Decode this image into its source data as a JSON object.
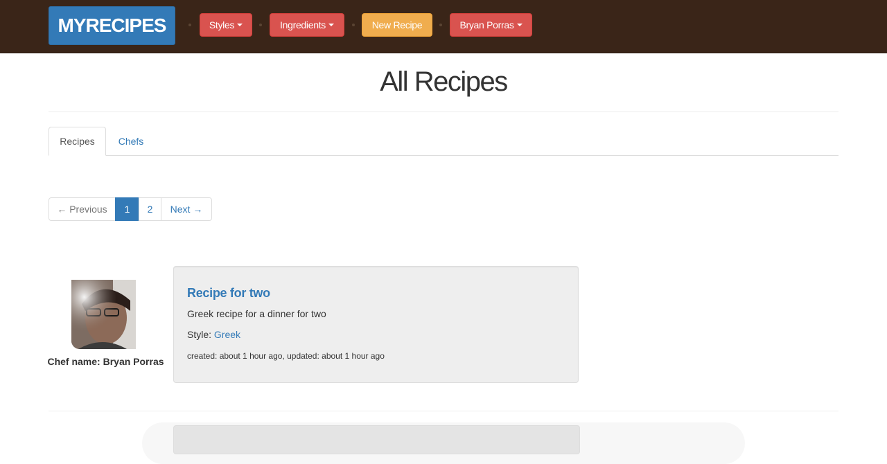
{
  "navbar": {
    "logo": "MYRECIPES",
    "styles_label": "Styles",
    "ingredients_label": "Ingredients",
    "new_recipe_label": "New Recipe",
    "user_label": "Bryan Porras",
    "colors": {
      "bar": "#3a2518",
      "logo": "#337ab7",
      "danger": "#d9534f",
      "warning": "#f0ad4e"
    }
  },
  "page": {
    "title": "All Recipes"
  },
  "tabs": [
    {
      "label": "Recipes",
      "active": true
    },
    {
      "label": "Chefs",
      "active": false
    }
  ],
  "pagination": {
    "previous": "← Previous",
    "pages": [
      "1",
      "2"
    ],
    "current": "1",
    "next": "Next →"
  },
  "recipes": [
    {
      "chef_label": "Chef name: Bryan Porras",
      "title": "Recipe for two",
      "description": "Greek recipe for a dinner for two",
      "style_prefix": "Style:",
      "style": "Greek",
      "meta": "created: about 1 hour ago, updated: about 1 hour ago"
    }
  ]
}
